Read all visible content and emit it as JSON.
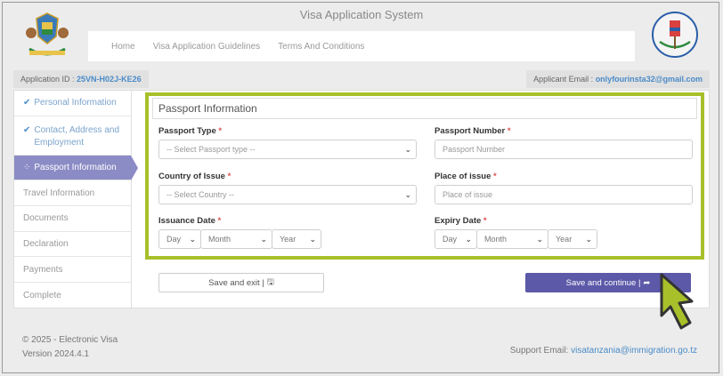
{
  "header": {
    "title": "Visa Application System",
    "nav": [
      "Home",
      "Visa Application Guidelines",
      "Terms And Conditions"
    ]
  },
  "info": {
    "application_id_label": "Application ID :",
    "application_id": "25VN-H02J-KE26",
    "email_label": "Applicant Email :",
    "email": "onlyfourinsta32@gmail.com"
  },
  "sidebar": {
    "items": [
      {
        "label": "Personal Information",
        "state": "done"
      },
      {
        "label": "Contact, Address and Employment",
        "state": "done"
      },
      {
        "label": "Passport Information",
        "state": "active"
      },
      {
        "label": "Travel Information",
        "state": "pending"
      },
      {
        "label": "Documents",
        "state": "pending"
      },
      {
        "label": "Declaration",
        "state": "pending"
      },
      {
        "label": "Payments",
        "state": "pending"
      },
      {
        "label": "Complete",
        "state": "pending"
      }
    ]
  },
  "form": {
    "section_title": "Passport Information",
    "required_mark": "*",
    "passport_type": {
      "label": "Passport Type",
      "value": "-- Select Passport type --"
    },
    "passport_number": {
      "label": "Passport Number",
      "placeholder": "Passport Number"
    },
    "country_of_issue": {
      "label": "Country of Issue",
      "value": "-- Select Country --"
    },
    "place_of_issue": {
      "label": "Place of issue",
      "placeholder": "Place of issue"
    },
    "issuance_date": {
      "label": "Issuance Date",
      "day": "Day",
      "month": "Month",
      "year": "Year"
    },
    "expiry_date": {
      "label": "Expiry Date",
      "day": "Day",
      "month": "Month",
      "year": "Year"
    }
  },
  "buttons": {
    "save_exit": "Save and exit |",
    "save_continue": "Save and continue |"
  },
  "footer": {
    "copyright": "© 2025 - Electronic Visa",
    "version": "Version 2024.4.1",
    "support_label": "Support Email:",
    "support_email": "visatanzania@immigration.go.tz"
  },
  "colors": {
    "accent": "#5c59a8",
    "highlight": "#a8c02a",
    "active_tab": "#8b8bc5",
    "link": "#4a8bc7"
  }
}
